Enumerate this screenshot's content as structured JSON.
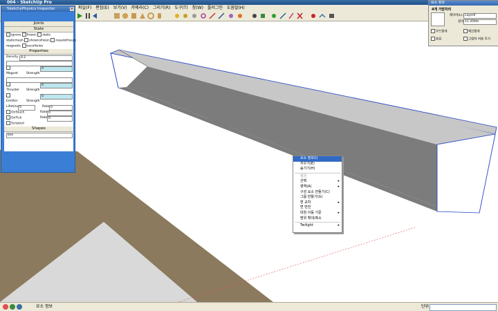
{
  "window": {
    "title": "004 - SketchUp Pro",
    "buttons": [
      "_",
      "□",
      "x"
    ]
  },
  "menubar": [
    "파일(F)",
    "편집(E)",
    "보기(V)",
    "카메라(C)",
    "그리기(R)",
    "도구(T)",
    "창(W)",
    "플러그인",
    "도움말(H)"
  ],
  "physics_panel": {
    "title": "SketchyPhysics Inspector",
    "tabs": [
      "Joints",
      "State"
    ],
    "state_row1": [
      "ignore",
      "frozen",
      "static"
    ],
    "state_row2": [
      "staticmesh",
      "showcollision",
      "noautofreeze"
    ],
    "state_row3": [
      "magnetic",
      "nocollision"
    ],
    "properties_header": "Properties",
    "density_label": "Density",
    "density_value": "0.2",
    "magnet_label": "Magnet",
    "magnet_strength_label": "Strength",
    "magnet_strength_value": "0",
    "thruster_label": "Thruster",
    "thruster_strength_label": "Strength",
    "thruster_strength_value": "0",
    "emitter_label": "Emitter",
    "emitter_strength_label": "Strength",
    "emitter_strength_value": "0",
    "lifetime_label": "Lifetime",
    "lifetime_value": "0",
    "rate_label": "Rate",
    "rate_value": "0",
    "ontouch_label": "OnTouch",
    "ontouch_rate_label": "Rate",
    "ontouch_rate_value": "0",
    "ontick_label": "OnTick",
    "ontick_rate_label": "Rate",
    "ontick_rate_value": "0",
    "scripted_label": "Scripted",
    "shapes_header": "Shapes",
    "shape_value": "box"
  },
  "layers_panel": {
    "title": "요소 정보",
    "heading": "4개 가장자리",
    "layer_label": "레이어(L):",
    "layer_value": "Layer0",
    "length_label": "길이:",
    "length_value": "11.359m",
    "checkbox1": "부드럽게",
    "checkbox2": "매끄럽게",
    "checkbox3": "숨김",
    "checkbox4": "그림자 허용 주기"
  },
  "context_menu": {
    "items": [
      {
        "label": "요소 정보(I)",
        "selected": true,
        "disabled": false,
        "arrow": false
      },
      {
        "label": "지우기(E)",
        "selected": false,
        "disabled": false,
        "arrow": false
      },
      {
        "label": "숨기기(H)",
        "selected": false,
        "disabled": false,
        "arrow": false
      },
      {
        "label": "잠금",
        "selected": false,
        "disabled": true,
        "arrow": false
      },
      {
        "label": "선택",
        "selected": false,
        "disabled": false,
        "arrow": true
      },
      {
        "label": "영역(A)",
        "selected": false,
        "disabled": false,
        "arrow": true
      },
      {
        "label": "구성 요소 만들기(C)",
        "selected": false,
        "disabled": false,
        "arrow": false
      },
      {
        "label": "그룹 만들기(G)",
        "selected": false,
        "disabled": false,
        "arrow": false
      },
      {
        "label": "면 교차",
        "selected": false,
        "disabled": false,
        "arrow": true
      },
      {
        "label": "면 반전",
        "selected": false,
        "disabled": false,
        "arrow": false
      },
      {
        "label": "대칭 이동 기준",
        "selected": false,
        "disabled": false,
        "arrow": true
      },
      {
        "label": "범위 확대/축소",
        "selected": false,
        "disabled": false,
        "arrow": false
      },
      {
        "label": "Twilight",
        "selected": false,
        "disabled": false,
        "arrow": true
      }
    ]
  },
  "statusbar": {
    "text": "요소 정보",
    "unit_label": "단위",
    "value_box": ""
  },
  "colors": {
    "titlebar": "#1d4f8a",
    "panel_blue": "#3a7fd5",
    "selection_blue": "#316ac5",
    "ground": "#8b7a5e",
    "face_gray": "#c7c7c7",
    "face_dark": "#7c7c7c",
    "edge_blue": "#1f3fc8"
  }
}
